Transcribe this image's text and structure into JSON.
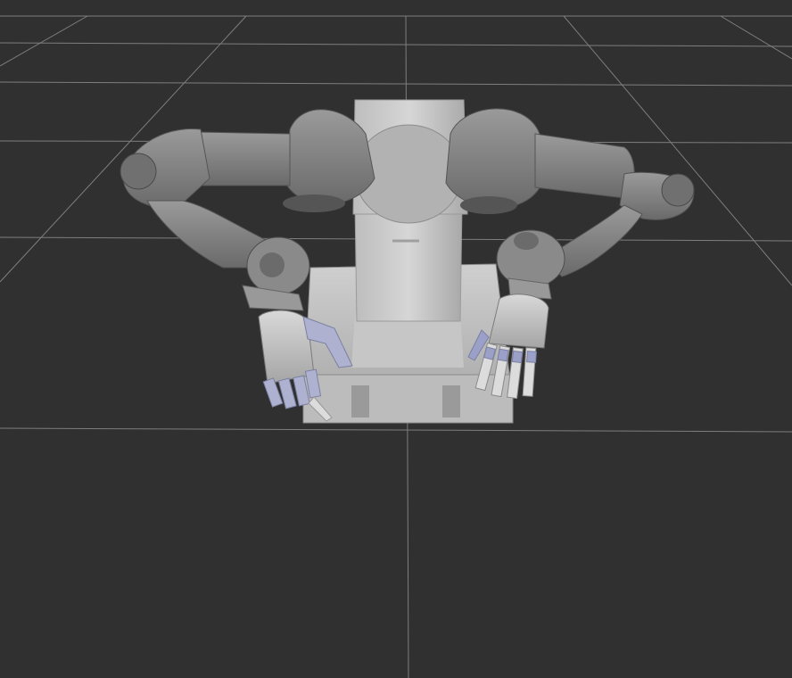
{
  "viewport": {
    "background_color": "#303030",
    "grid_color": "#a0a0a0",
    "model_body_color": "#8a8a8a",
    "model_light_color": "#c8c8c8",
    "finger_accent_color": "#9aa0c8"
  },
  "scene": {
    "view_type": "3d-render",
    "grid": true,
    "model": "dual-arm-robot-with-hands"
  }
}
